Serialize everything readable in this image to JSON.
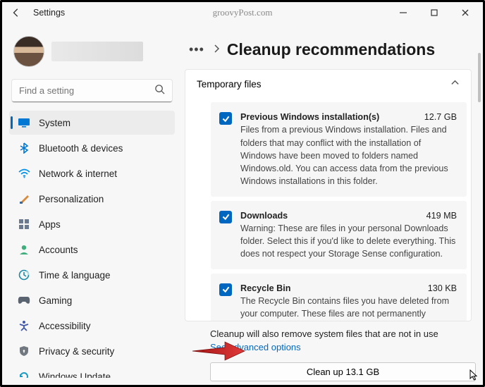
{
  "window": {
    "back_icon": "←",
    "title": "Settings",
    "watermark": "groovyPost.com"
  },
  "search": {
    "placeholder": "Find a setting"
  },
  "sidebar": {
    "items": [
      {
        "label": "System",
        "icon": "system",
        "active": true
      },
      {
        "label": "Bluetooth & devices",
        "icon": "bluetooth"
      },
      {
        "label": "Network & internet",
        "icon": "wifi"
      },
      {
        "label": "Personalization",
        "icon": "brush"
      },
      {
        "label": "Apps",
        "icon": "apps"
      },
      {
        "label": "Accounts",
        "icon": "account"
      },
      {
        "label": "Time & language",
        "icon": "clock"
      },
      {
        "label": "Gaming",
        "icon": "gaming"
      },
      {
        "label": "Accessibility",
        "icon": "accessibility"
      },
      {
        "label": "Privacy & security",
        "icon": "privacy"
      },
      {
        "label": "Windows Update",
        "icon": "update"
      }
    ]
  },
  "page": {
    "title": "Cleanup recommendations",
    "section": "Temporary files",
    "items": [
      {
        "name": "Previous Windows installation(s)",
        "size": "12.7 GB",
        "desc": "Files from a previous Windows installation.  Files and folders that may conflict with the installation of Windows have been moved to folders named Windows.old.  You can access data from the previous Windows installations in this folder.",
        "checked": true
      },
      {
        "name": "Downloads",
        "size": "419 MB",
        "desc": "Warning: These are files in your personal Downloads folder. Select this if you'd like to delete everything. This does not respect your Storage Sense configuration.",
        "checked": true
      },
      {
        "name": "Recycle Bin",
        "size": "130 KB",
        "desc": "The Recycle Bin contains files you have deleted from your computer. These files are not permanently removed until you empty the Recycle Bin.",
        "checked": true
      }
    ],
    "note": "Cleanup will also remove system files that are not in use",
    "advanced_link": "See advanced options",
    "button": "Clean up 13.1 GB"
  }
}
